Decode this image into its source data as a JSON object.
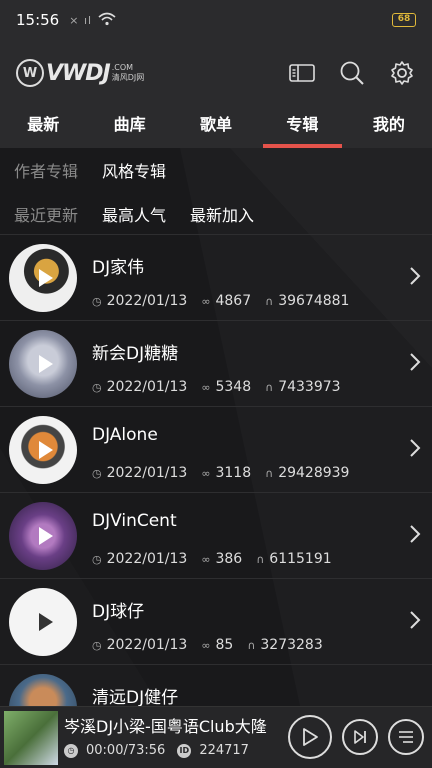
{
  "status": {
    "time": "15:56",
    "signal": "× ıl",
    "battery": "68"
  },
  "header": {
    "logo_mark": "W",
    "logo_word": "VWDJ",
    "logo_com": ".COM",
    "logo_sub": "清风DJ网"
  },
  "tabs": [
    {
      "label": "最新"
    },
    {
      "label": "曲库"
    },
    {
      "label": "歌单"
    },
    {
      "label": "专辑",
      "active": true
    },
    {
      "label": "我的"
    }
  ],
  "filters": {
    "row1": {
      "label": "作者专辑",
      "option": "风格专辑"
    },
    "row2": {
      "label": "最近更新",
      "options": [
        "最高人气",
        "最新加入"
      ]
    }
  },
  "albums": [
    {
      "name": "DJ家伟",
      "date": "2022/01/13",
      "count": "4867",
      "plays": "39674881"
    },
    {
      "name": "新会DJ糖糖",
      "date": "2022/01/13",
      "count": "5348",
      "plays": "7433973"
    },
    {
      "name": "DJAlone",
      "date": "2022/01/13",
      "count": "3118",
      "plays": "29428939"
    },
    {
      "name": "DJVinCent",
      "date": "2022/01/13",
      "count": "386",
      "plays": "6115191"
    },
    {
      "name": "DJ球仔",
      "date": "2022/01/13",
      "count": "85",
      "plays": "3273283"
    },
    {
      "name": "清远DJ健仔",
      "date": "",
      "count": "",
      "plays": ""
    }
  ],
  "player": {
    "title": "岑溪DJ小梁-国粤语Club大隆",
    "time": "00:00/73:56",
    "id_label": "ID",
    "id": "224717"
  }
}
